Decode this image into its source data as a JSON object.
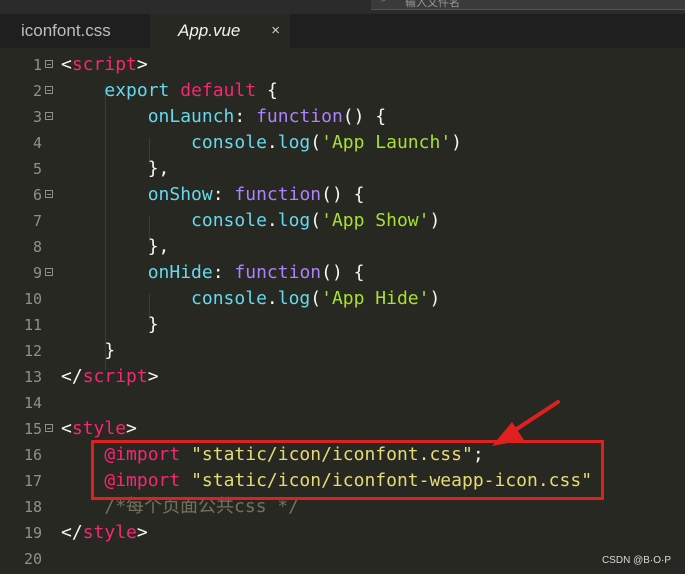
{
  "search": {
    "placeholder": "输入文件名"
  },
  "tabs": [
    {
      "label": "iconfont.css",
      "active": false
    },
    {
      "label": "App.vue",
      "active": true,
      "close_glyph": "×"
    }
  ],
  "lines": [
    {
      "n": "1"
    },
    {
      "n": "2"
    },
    {
      "n": "3"
    },
    {
      "n": "4"
    },
    {
      "n": "5"
    },
    {
      "n": "6"
    },
    {
      "n": "7"
    },
    {
      "n": "8"
    },
    {
      "n": "9"
    },
    {
      "n": "10"
    },
    {
      "n": "11"
    },
    {
      "n": "12"
    },
    {
      "n": "13"
    },
    {
      "n": "14"
    },
    {
      "n": "15"
    },
    {
      "n": "16"
    },
    {
      "n": "17"
    },
    {
      "n": "18"
    },
    {
      "n": "19"
    },
    {
      "n": "20"
    }
  ],
  "code": {
    "l1": {
      "open": "<",
      "tag": "script",
      "close": ">"
    },
    "l2": {
      "kw1": "export",
      "kw2": "default",
      "brace": "{"
    },
    "l3": {
      "name": "onLaunch",
      "colon": ":",
      "kw": "function",
      "rest": "() {"
    },
    "l4": {
      "obj": "console",
      "dot": ".",
      "method": "log",
      "open": "(",
      "str": "'App Launch'",
      "close": ")"
    },
    "l5": {
      "text": "},"
    },
    "l6": {
      "name": "onShow",
      "colon": ":",
      "kw": "function",
      "rest": "() {"
    },
    "l7": {
      "obj": "console",
      "dot": ".",
      "method": "log",
      "open": "(",
      "str": "'App Show'",
      "close": ")"
    },
    "l8": {
      "text": "},"
    },
    "l9": {
      "name": "onHide",
      "colon": ":",
      "kw": "function",
      "rest": "() {"
    },
    "l10": {
      "obj": "console",
      "dot": ".",
      "method": "log",
      "open": "(",
      "str": "'App Hide'",
      "close": ")"
    },
    "l11": {
      "text": "}"
    },
    "l12": {
      "text": "}"
    },
    "l13": {
      "open": "</",
      "tag": "script",
      "close": ">"
    },
    "l15": {
      "open": "<",
      "tag": "style",
      "close": ">"
    },
    "l16": {
      "at": "@import",
      "str": "\"static/icon/iconfont.css\"",
      "semi": ";"
    },
    "l17": {
      "at": "@import",
      "str": "\"static/icon/iconfont-weapp-icon.css\""
    },
    "l18": {
      "comment": "/*每个页面公共css */"
    },
    "l19": {
      "open": "</",
      "tag": "style",
      "close": ">"
    }
  },
  "annotation": {
    "color": "#e02020"
  },
  "watermark": "CSDN @B·O·P",
  "colors": {
    "background": "#272822",
    "tag": "#f92672",
    "function_name": "#a6e22e",
    "builtin": "#66d9ef",
    "string": "#e6db74",
    "comment": "#75715e",
    "annotation": "#e02020"
  }
}
